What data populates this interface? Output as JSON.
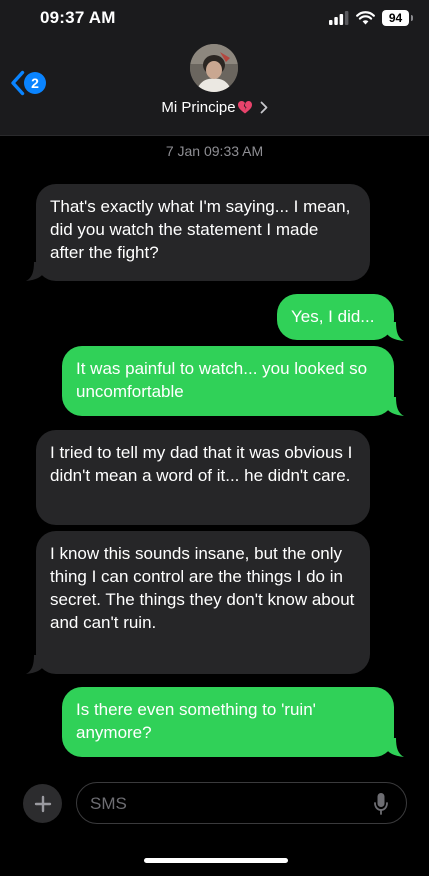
{
  "status_bar": {
    "time": "09:37 AM",
    "battery": "94"
  },
  "header": {
    "back_badge": "2",
    "contact_name": "Mi Principe"
  },
  "conversation": {
    "timestamp": "7 Jan 09:33 AM",
    "messages": [
      {
        "direction": "incoming",
        "text": "That's exactly what I'm saying... I mean, did you watch the statement I made after the fight?"
      },
      {
        "direction": "outgoing",
        "text": "Yes, I did..."
      },
      {
        "direction": "outgoing",
        "text": "It was painful to watch... you looked so uncomfortable"
      },
      {
        "direction": "incoming",
        "text": "I tried to tell my dad that it was obvious I didn't mean a word of it... he didn't care."
      },
      {
        "direction": "incoming",
        "text": "I know this sounds insane, but the only thing I can control are the things I do in secret. The things they don't know about and can't ruin."
      },
      {
        "direction": "outgoing",
        "text": "Is there even something to 'ruin' anymore?"
      }
    ]
  },
  "composer": {
    "placeholder": "SMS"
  },
  "icons": {
    "back": "chevron-left-icon",
    "heart": "broken-heart-icon",
    "contact_details": "chevron-right-icon",
    "add": "plus-icon",
    "mic": "microphone-icon",
    "signal": "signal-icon",
    "wifi": "wifi-icon",
    "battery": "battery-icon"
  },
  "colors": {
    "outgoing_bubble": "#30d158",
    "incoming_bubble": "#262628",
    "accent": "#0a84ff",
    "heart": "#e8436b"
  }
}
